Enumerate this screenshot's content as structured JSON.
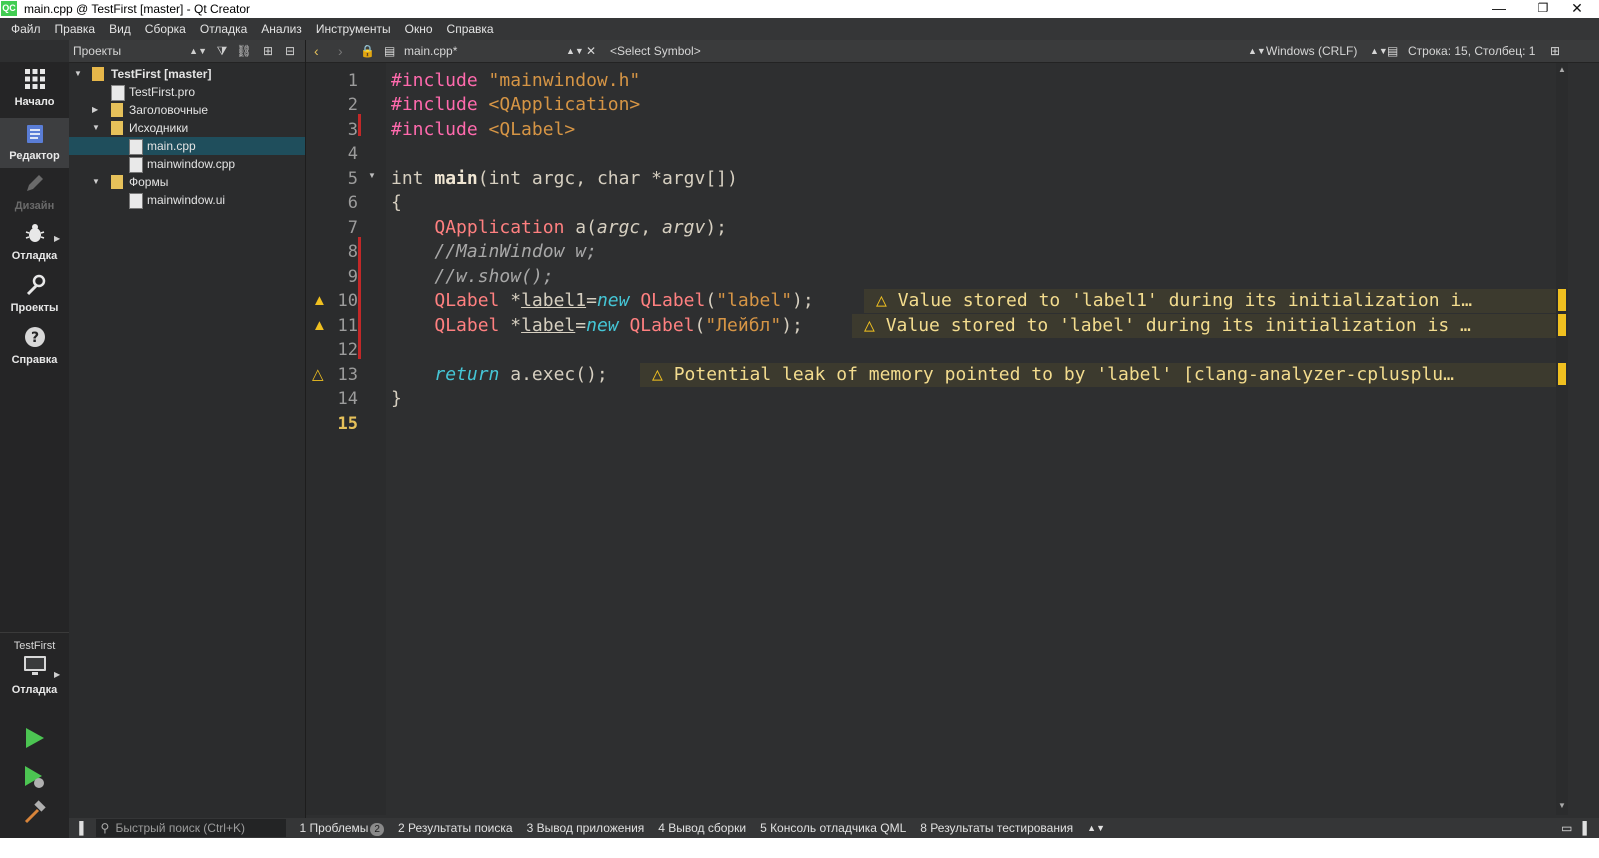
{
  "window": {
    "title": "main.cpp @ TestFirst [master] - Qt Creator",
    "logo": "QC"
  },
  "menu": [
    "Файл",
    "Правка",
    "Вид",
    "Сборка",
    "Отладка",
    "Анализ",
    "Инструменты",
    "Окно",
    "Справка"
  ],
  "modes": {
    "welcome": "Начало",
    "edit": "Редактор",
    "design": "Дизайн",
    "debug": "Отладка",
    "projects": "Проекты",
    "help": "Справка"
  },
  "kit": {
    "name": "TestFirst",
    "build_config": "Отладка"
  },
  "projects_panel": {
    "selector": "Проекты",
    "tree": [
      {
        "label": "TestFirst [master]",
        "level": 0,
        "expanded": true,
        "bold": true,
        "icon": "project-icon"
      },
      {
        "label": "TestFirst.pro",
        "level": 1,
        "icon": "pro-file-icon"
      },
      {
        "label": "Заголовочные",
        "level": 1,
        "expanded": false,
        "icon": "headers-folder-icon"
      },
      {
        "label": "Исходники",
        "level": 1,
        "expanded": true,
        "icon": "sources-folder-icon"
      },
      {
        "label": "main.cpp",
        "level": 2,
        "selected": true,
        "icon": "cpp-file-icon"
      },
      {
        "label": "mainwindow.cpp",
        "level": 2,
        "icon": "cpp-file-icon"
      },
      {
        "label": "Формы",
        "level": 1,
        "expanded": true,
        "icon": "forms-folder-icon"
      },
      {
        "label": "mainwindow.ui",
        "level": 2,
        "icon": "ui-file-icon"
      }
    ]
  },
  "editor_toolbar": {
    "file": "main.cpp*",
    "symbol": "<Select Symbol>",
    "line_ending": "Windows (CRLF)",
    "position": "Строка: 15, Столбец: 1"
  },
  "editor": {
    "current_line": 15,
    "diagnostics": {
      "d10": "Value stored to 'label1' during its initialization i…",
      "d11": "Value stored to 'label' during its initialization is …",
      "d13": "Potential leak of memory pointed to by 'label' [clang-analyzer-cplusplu…"
    },
    "warning_lines": [
      10,
      11,
      13
    ]
  },
  "status": {
    "search_placeholder": "Быстрый поиск (Ctrl+K)",
    "problems": "1 Проблемы",
    "problems_count": "2",
    "search_results": "2 Результаты поиска",
    "app_output": "3 Вывод приложения",
    "compile_output": "4 Вывод сборки",
    "qml_console": "5 Консоль отладчика QML",
    "test_results": "8 Результаты тестирования"
  },
  "colors": {
    "preprocessor": "#ff6aad",
    "string": "#d69545",
    "type": "#ff8080",
    "new_keyword": "#45c6d6",
    "warning": "#f0c020",
    "selection": "#1f4e5c"
  }
}
